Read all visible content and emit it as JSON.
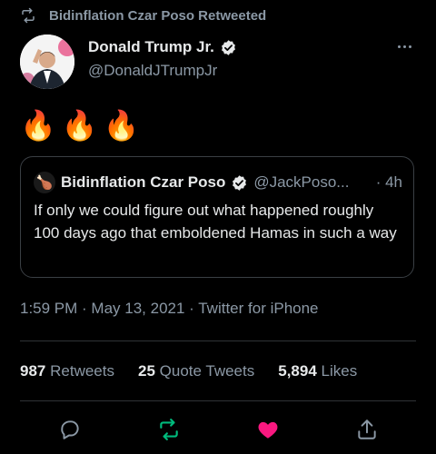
{
  "retweet_banner": {
    "text": "Bidinflation Czar Poso Retweeted",
    "icon": "retweet-icon"
  },
  "tweet": {
    "author_name": "Donald Trump Jr.",
    "author_handle": "@DonaldJTrumpJr",
    "verified": true,
    "body_emoji": [
      "🔥",
      "🔥",
      "🔥"
    ],
    "quote": {
      "avatar_emoji": "🍗",
      "name": "Bidinflation Czar Poso",
      "handle": "@JackPoso...",
      "time": "· 4h",
      "text": "If only we could figure out what happened roughly 100 days ago that emboldened Hamas in such a way"
    },
    "meta": "1:59 PM · May 13, 2021 · Twitter for iPhone",
    "stats": {
      "retweets_count": "987",
      "retweets_label": "Retweets",
      "quotes_count": "25",
      "quotes_label": "Quote Tweets",
      "likes_count": "5,894",
      "likes_label": "Likes"
    },
    "actions": [
      "reply-icon",
      "retweet-icon",
      "like-icon",
      "share-icon"
    ]
  },
  "colors": {
    "background": "#000000",
    "text": "#e7e9ea",
    "secondary": "#8b98a5",
    "verified": "#e7e9ea",
    "retweet_active": "#00ba7c",
    "like_active": "#f91880"
  }
}
